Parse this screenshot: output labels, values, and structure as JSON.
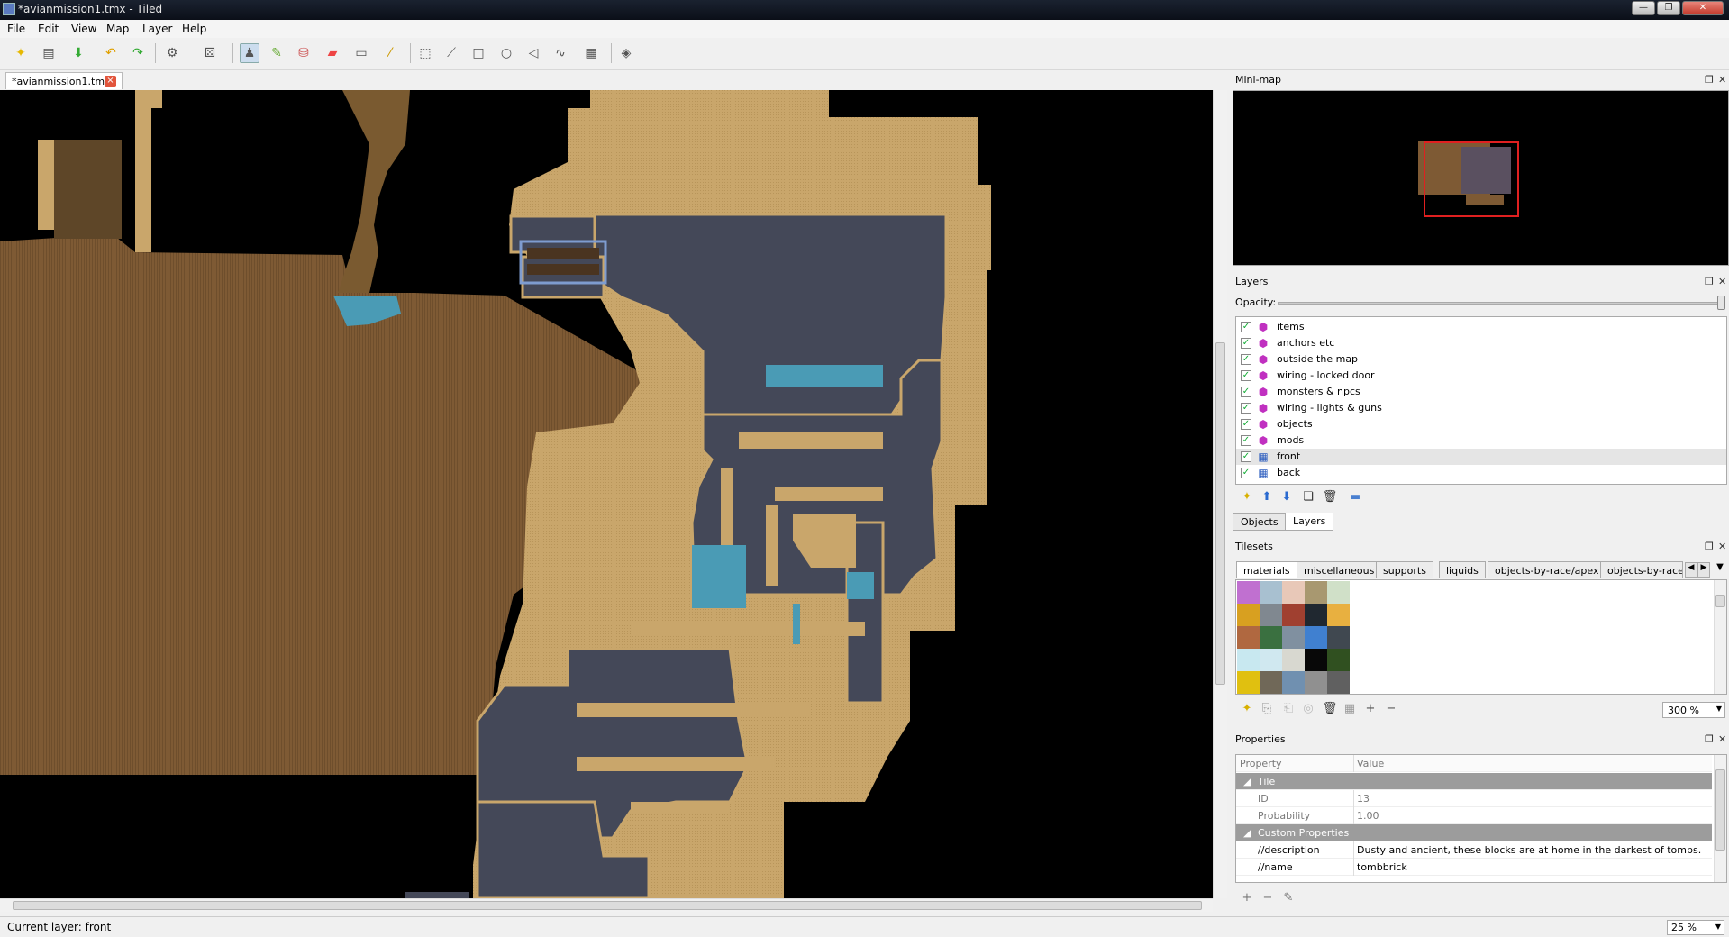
{
  "window": {
    "title": "*avianmission1.tmx - Tiled"
  },
  "menubar": {
    "items": [
      "File",
      "Edit",
      "View",
      "Map",
      "Layer",
      "Help"
    ]
  },
  "document_tab": {
    "label": "*avianmission1.tmx"
  },
  "docks": {
    "minimap": {
      "title": "Mini-map"
    },
    "layers": {
      "title": "Layers",
      "opacity_label": "Opacity:",
      "items": [
        {
          "name": "items",
          "type": "object",
          "visible": true
        },
        {
          "name": "anchors etc",
          "type": "object",
          "visible": true
        },
        {
          "name": "outside the map",
          "type": "object",
          "visible": true
        },
        {
          "name": "wiring - locked door",
          "type": "object",
          "visible": true
        },
        {
          "name": "monsters & npcs",
          "type": "object",
          "visible": true
        },
        {
          "name": "wiring - lights & guns",
          "type": "object",
          "visible": true
        },
        {
          "name": "objects",
          "type": "object",
          "visible": true
        },
        {
          "name": "mods",
          "type": "object",
          "visible": true
        },
        {
          "name": "front",
          "type": "tile",
          "visible": true,
          "selected": true
        },
        {
          "name": "back",
          "type": "tile",
          "visible": true
        }
      ],
      "bottom_tabs": [
        "Objects",
        "Layers"
      ],
      "active_tab": "Layers"
    },
    "tilesets": {
      "title": "Tilesets",
      "tabs": [
        "materials",
        "miscellaneous",
        "supports",
        "liquids",
        "objects-by-race/apex",
        "objects-by-race"
      ],
      "active_tab": "materials",
      "zoom": "300 %"
    },
    "properties": {
      "title": "Properties",
      "header": {
        "property": "Property",
        "value": "Value"
      },
      "groups": [
        {
          "name": "Tile",
          "rows": [
            {
              "key": "ID",
              "value": "13"
            },
            {
              "key": "Probability",
              "value": "1.00"
            }
          ]
        },
        {
          "name": "Custom Properties",
          "rows": [
            {
              "key": "//description",
              "value": "Dusty and ancient, these blocks are at home in the darkest of tombs."
            },
            {
              "key": "//name",
              "value": "tombbrick"
            }
          ]
        }
      ]
    }
  },
  "statusbar": {
    "current_layer": "Current layer: front",
    "zoom": "25 %"
  },
  "colors": {
    "sand": "#c9a66b",
    "dirt": "#7e5a34",
    "stone": "#444858",
    "water": "#4a9bb5",
    "selection": "#e02020"
  }
}
